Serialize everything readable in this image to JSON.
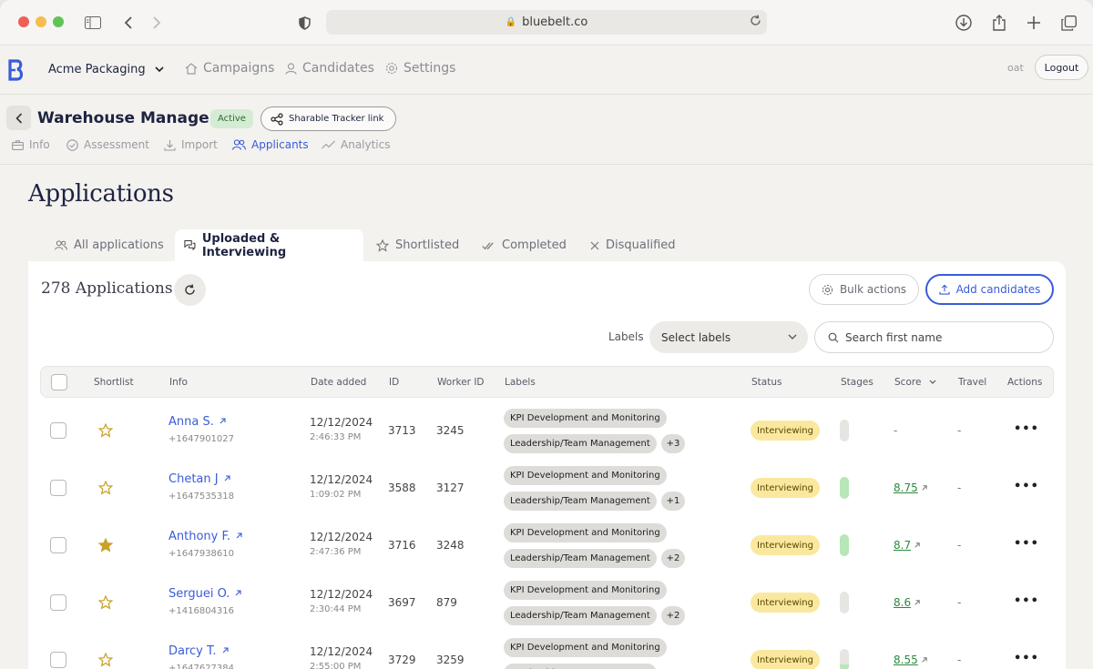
{
  "browser": {
    "url": "bluebelt.co"
  },
  "nav": {
    "org": "Acme Packaging",
    "links": [
      "Campaigns",
      "Candidates",
      "Settings"
    ],
    "user": "oat",
    "logout": "Logout"
  },
  "job": {
    "title": "Warehouse Manager",
    "status": "Active",
    "share": "Sharable Tracker link",
    "subtabs": [
      "Info",
      "Assessment",
      "Import",
      "Applicants",
      "Analytics"
    ],
    "selected_subtab": "Applicants"
  },
  "page": {
    "title": "Applications"
  },
  "tabs": [
    "All applications",
    "Uploaded & Interviewing",
    "Shortlisted",
    "Completed",
    "Disqualified"
  ],
  "selected_tab": "Uploaded & Interviewing",
  "toolbar": {
    "count": "278 Applications",
    "bulk": "Bulk actions",
    "add": "Add candidates",
    "labels_label": "Labels",
    "labels_placeholder": "Select labels",
    "search_placeholder": "Search first name"
  },
  "columns": [
    "Shortlist",
    "Info",
    "Date added",
    "ID",
    "Worker ID",
    "Labels",
    "Status",
    "Stages",
    "Score",
    "Travel",
    "Actions"
  ],
  "rows": [
    {
      "name": "Anna S.",
      "phone": "+1647901027",
      "date": "12/12/2024",
      "time": "2:46:33 PM",
      "id": "3713",
      "worker": "3245",
      "label1": "KPI Development and Monitoring",
      "label2": "Leadership/Team Management",
      "more": "+3",
      "status": "Interviewing",
      "stage": 0,
      "score": "-",
      "travel": "-",
      "starred": false
    },
    {
      "name": "Chetan J",
      "phone": "+1647535318",
      "date": "12/12/2024",
      "time": "1:09:02 PM",
      "id": "3588",
      "worker": "3127",
      "label1": "KPI Development and Monitoring",
      "label2": "Leadership/Team Management",
      "more": "+1",
      "status": "Interviewing",
      "stage": 1,
      "score": "8.75",
      "travel": "-",
      "starred": false
    },
    {
      "name": "Anthony F.",
      "phone": "+1647938610",
      "date": "12/12/2024",
      "time": "2:47:36 PM",
      "id": "3716",
      "worker": "3248",
      "label1": "KPI Development and Monitoring",
      "label2": "Leadership/Team Management",
      "more": "+2",
      "status": "Interviewing",
      "stage": 1,
      "score": "8.7",
      "travel": "-",
      "starred": true
    },
    {
      "name": "Serguei O.",
      "phone": "+1416804316",
      "date": "12/12/2024",
      "time": "2:30:44 PM",
      "id": "3697",
      "worker": "879",
      "label1": "KPI Development and Monitoring",
      "label2": "Leadership/Team Management",
      "more": "+2",
      "status": "Interviewing",
      "stage": 0,
      "score": "8.6",
      "travel": "-",
      "starred": false
    },
    {
      "name": "Darcy T.",
      "phone": "+1647627384",
      "date": "12/12/2024",
      "time": "2:55:00 PM",
      "id": "3729",
      "worker": "3259",
      "label1": "KPI Development and Monitoring",
      "label2": "Leadership/Team Management",
      "more": "",
      "status": "Interviewing",
      "stage": 0.3,
      "score": "8.55",
      "travel": "-",
      "starred": false
    }
  ],
  "colors": {
    "accent": "#3a5bd9",
    "active_badge": "#d4ecd3",
    "status_badge": "#fae89e",
    "score": "#2b8a3e"
  }
}
